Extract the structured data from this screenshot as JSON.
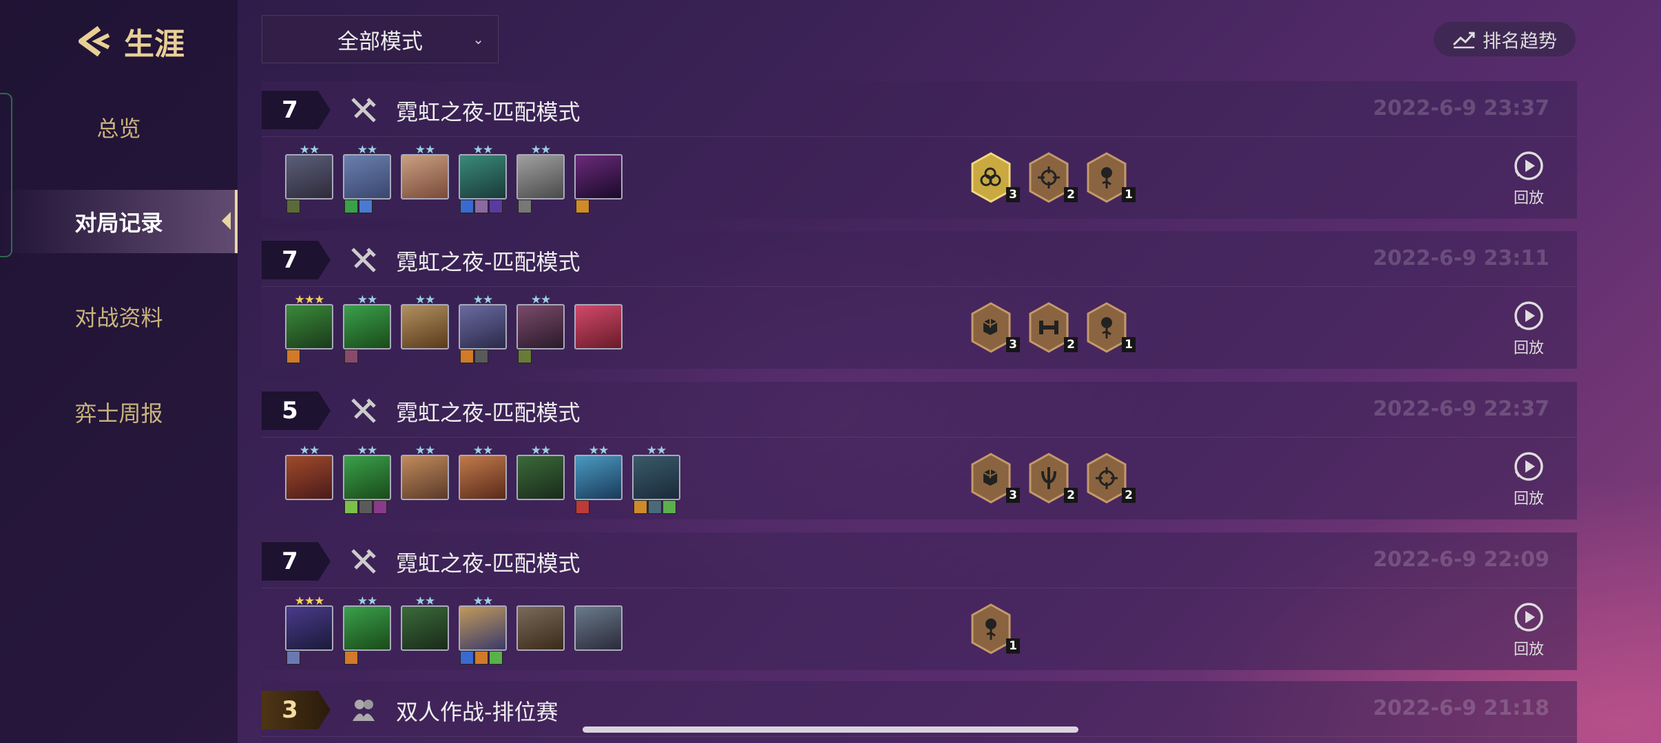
{
  "sidebar": {
    "title": "生涯",
    "items": [
      {
        "label": "总览",
        "active": false
      },
      {
        "label": "对局记录",
        "active": true
      },
      {
        "label": "对战资料",
        "active": false
      },
      {
        "label": "弈士周报",
        "active": false
      }
    ]
  },
  "topbar": {
    "mode_select": "全部模式",
    "trend_button": "排名趋势"
  },
  "replay_label": "回放",
  "matches": [
    {
      "rank": "7",
      "mode": "霓虹之夜-匹配模式",
      "mode_icon": "crossed-swords-icon",
      "time": "2022-6-9 23:37",
      "champions": [
        {
          "stars": 2,
          "colors": [
            "#5b5f7a",
            "#2f2a3a"
          ],
          "items": [
            "#5a6a3a"
          ]
        },
        {
          "stars": 2,
          "colors": [
            "#6a7fb0",
            "#39466d"
          ],
          "items": [
            "#3aa04a",
            "#4a7ad0"
          ]
        },
        {
          "stars": 2,
          "colors": [
            "#c8a080",
            "#7a4a3a"
          ],
          "items": []
        },
        {
          "stars": 2,
          "colors": [
            "#3a8a7a",
            "#1a3a3a"
          ],
          "items": [
            "#3a6ad0",
            "#8a6aa0",
            "#5a3aa0"
          ]
        },
        {
          "stars": 2,
          "colors": [
            "#a0a0a0",
            "#4a4a4a"
          ],
          "items": [
            "#777"
          ]
        },
        {
          "stars": 0,
          "colors": [
            "#6a2a7a",
            "#1a0a2a"
          ],
          "items": [
            "#d08a2a"
          ]
        }
      ],
      "traits": [
        {
          "icon": "rings-icon",
          "count": "3",
          "tier": "gold"
        },
        {
          "icon": "crosshair-icon",
          "count": "2",
          "tier": "bronze"
        },
        {
          "icon": "rose-icon",
          "count": "1",
          "tier": "bronze"
        }
      ]
    },
    {
      "rank": "7",
      "mode": "霓虹之夜-匹配模式",
      "mode_icon": "crossed-swords-icon",
      "time": "2022-6-9 23:11",
      "champions": [
        {
          "stars": 3,
          "colors": [
            "#3a8a3a",
            "#1a3a1a"
          ],
          "items": [
            "#d07a2a"
          ]
        },
        {
          "stars": 2,
          "colors": [
            "#3aa04a",
            "#1a4a1a"
          ],
          "items": [
            "#8a4a6a"
          ]
        },
        {
          "stars": 2,
          "colors": [
            "#b09060",
            "#5a3a1a"
          ],
          "items": []
        },
        {
          "stars": 2,
          "colors": [
            "#6a6aa0",
            "#2a2a4a"
          ],
          "items": [
            "#d07a2a",
            "#5a5a5a"
          ]
        },
        {
          "stars": 2,
          "colors": [
            "#7a4a6a",
            "#2a1a2a"
          ],
          "items": [
            "#6a7a3a"
          ]
        },
        {
          "stars": 0,
          "colors": [
            "#d04a6a",
            "#6a1a2a"
          ],
          "items": []
        }
      ],
      "traits": [
        {
          "icon": "cubes-icon",
          "count": "3",
          "tier": "bronze"
        },
        {
          "icon": "dumbbell-icon",
          "count": "2",
          "tier": "bronze"
        },
        {
          "icon": "rose-icon",
          "count": "1",
          "tier": "bronze"
        }
      ]
    },
    {
      "rank": "5",
      "mode": "霓虹之夜-匹配模式",
      "mode_icon": "crossed-swords-icon",
      "time": "2022-6-9 22:37",
      "champions": [
        {
          "stars": 2,
          "colors": [
            "#a04a2a",
            "#4a1a1a"
          ],
          "items": []
        },
        {
          "stars": 2,
          "colors": [
            "#3aa04a",
            "#1a4a1a"
          ],
          "items": [
            "#7ac04a",
            "#5a5a5a",
            "#8a3a8a"
          ]
        },
        {
          "stars": 2,
          "colors": [
            "#c08a5a",
            "#5a3a2a"
          ],
          "items": []
        },
        {
          "stars": 2,
          "colors": [
            "#c07a4a",
            "#5a2a1a"
          ],
          "items": []
        },
        {
          "stars": 2,
          "colors": [
            "#3a6a3a",
            "#1a2a1a"
          ],
          "items": []
        },
        {
          "stars": 2,
          "colors": [
            "#4a9ac0",
            "#1a3a5a"
          ],
          "items": [
            "#c03a3a"
          ]
        },
        {
          "stars": 2,
          "colors": [
            "#3a5a6a",
            "#1a2a3a"
          ],
          "items": [
            "#d08a2a",
            "#4a6a7a",
            "#5ab04a"
          ]
        }
      ],
      "traits": [
        {
          "icon": "cubes-icon",
          "count": "3",
          "tier": "bronze"
        },
        {
          "icon": "trident-icon",
          "count": "2",
          "tier": "bronze"
        },
        {
          "icon": "crosshair-icon",
          "count": "2",
          "tier": "bronze"
        }
      ]
    },
    {
      "rank": "7",
      "mode": "霓虹之夜-匹配模式",
      "mode_icon": "crossed-swords-icon",
      "time": "2022-6-9 22:09",
      "champions": [
        {
          "stars": 3,
          "colors": [
            "#4a3a8a",
            "#1a1a3a"
          ],
          "items": [
            "#6a7ab0"
          ]
        },
        {
          "stars": 2,
          "colors": [
            "#3aa04a",
            "#1a4a1a"
          ],
          "items": [
            "#d07a2a"
          ]
        },
        {
          "stars": 2,
          "colors": [
            "#3a6a3a",
            "#1a2a1a"
          ],
          "items": []
        },
        {
          "stars": 2,
          "colors": [
            "#c09a5a",
            "#3a3a6a"
          ],
          "items": [
            "#3a6ad0",
            "#d07a2a",
            "#5ab04a"
          ]
        },
        {
          "stars": 0,
          "colors": [
            "#7a6a5a",
            "#3a2a1a"
          ],
          "items": []
        },
        {
          "stars": 0,
          "colors": [
            "#6a7a8a",
            "#2a2a3a"
          ],
          "items": []
        }
      ],
      "traits": [
        {
          "icon": "rose-icon",
          "count": "1",
          "tier": "bronze"
        }
      ]
    },
    {
      "rank": "3",
      "mode": "双人作战-排位赛",
      "mode_icon": "duo-icon",
      "time": "2022-6-9 21:18",
      "champions": [],
      "traits": []
    }
  ]
}
